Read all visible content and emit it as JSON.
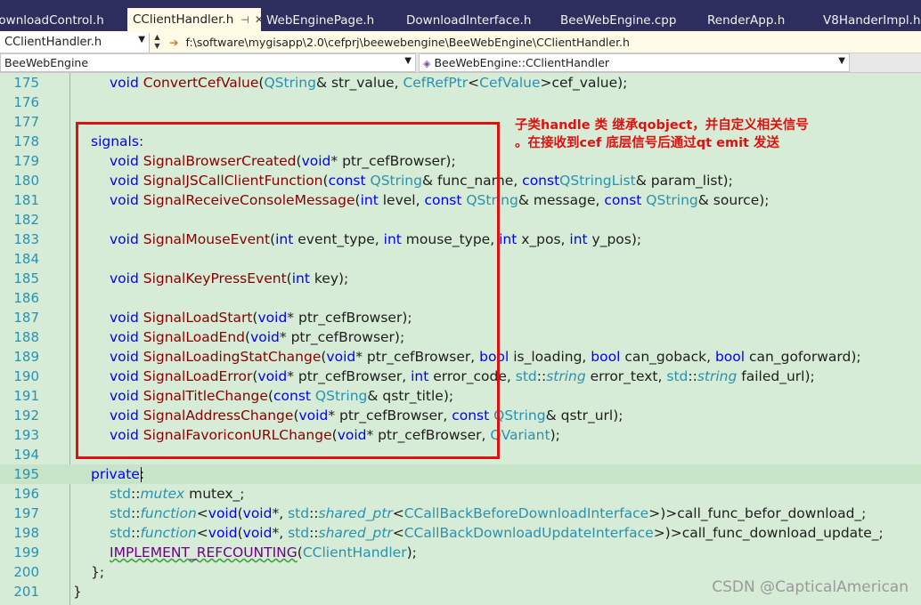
{
  "tabs": [
    {
      "label": "DownloadControl.h",
      "active": false
    },
    {
      "label": "CClientHandler.h",
      "active": true,
      "pin": "⊣",
      "close": "✕"
    },
    {
      "label": "WebEnginePage.h",
      "active": false
    },
    {
      "label": "DownloadInterface.h",
      "active": false
    },
    {
      "label": "BeeWebEngine.cpp",
      "active": false
    },
    {
      "label": "RenderApp.h",
      "active": false
    },
    {
      "label": "V8HanderImpl.h",
      "active": false
    }
  ],
  "pathbar": {
    "class_selector": "CClientHandler.h",
    "path": "f:\\software\\mygisapp\\2.0\\cefprj\\beewebengine\\BeeWebEngine\\CClientHandler.h"
  },
  "scopebar": {
    "project": "BeeWebEngine",
    "member": "BeeWebEngine::CClientHandler"
  },
  "code": {
    "lines": [
      {
        "n": "175",
        "html": "<span class='kw'>void</span> <span class='fn'>ConvertCefValue</span>(<span class='ty'>QString</span>&amp; str_value, <span class='ty'>CefRefPtr</span>&lt;<span class='ty'>CefValue</span>&gt;cef_value);",
        "indent": 2
      },
      {
        "n": "176",
        "html": "",
        "indent": 2
      },
      {
        "n": "177",
        "html": "",
        "indent": 2
      },
      {
        "n": "178",
        "html": "<span class='kw'>signals</span>:",
        "indent": 1
      },
      {
        "n": "179",
        "html": "<span class='kw'>void</span> <span class='fn'>SignalBrowserCreated</span>(<span class='kw'>void</span>* ptr_cefBrowser);",
        "indent": 2
      },
      {
        "n": "180",
        "html": "<span class='kw'>void</span> <span class='fn'>SignalJSCallClientFunction</span>(<span class='kw'>const</span> <span class='ty'>QString</span>&amp; func_name, <span class='kw'>const</span><span class='ty'>QStringList</span>&amp; param_list);",
        "indent": 2
      },
      {
        "n": "181",
        "html": "<span class='kw'>void</span> <span class='fn'>SignalReceiveConsoleMessage</span>(<span class='kw'>int</span> level, <span class='kw'>const</span> <span class='ty'>QString</span>&amp; message, <span class='kw'>const</span> <span class='ty'>QString</span>&amp; source);",
        "indent": 2
      },
      {
        "n": "182",
        "html": "",
        "indent": 2
      },
      {
        "n": "183",
        "html": "<span class='kw'>void</span> <span class='fn'>SignalMouseEvent</span>(<span class='kw'>int</span> event_type, <span class='kw'>int</span> mouse_type, <span class='kw'>int</span> x_pos, <span class='kw'>int</span> y_pos);",
        "indent": 2
      },
      {
        "n": "184",
        "html": "",
        "indent": 2
      },
      {
        "n": "185",
        "html": "<span class='kw'>void</span> <span class='fn'>SignalKeyPressEvent</span>(<span class='kw'>int</span> key);",
        "indent": 2
      },
      {
        "n": "186",
        "html": "",
        "indent": 2
      },
      {
        "n": "187",
        "html": "<span class='kw'>void</span> <span class='fn'>SignalLoadStart</span>(<span class='kw'>void</span>* ptr_cefBrowser);",
        "indent": 2
      },
      {
        "n": "188",
        "html": "<span class='kw'>void</span> <span class='fn'>SignalLoadEnd</span>(<span class='kw'>void</span>* ptr_cefBrowser);",
        "indent": 2
      },
      {
        "n": "189",
        "html": "<span class='kw'>void</span> <span class='fn'>SignalLoadingStatChange</span>(<span class='kw'>void</span>* ptr_cefBrowser, <span class='kw'>bool</span> is_loading, <span class='kw'>bool</span> can_goback, <span class='kw'>bool</span> can_goforward);",
        "indent": 2
      },
      {
        "n": "190",
        "html": "<span class='kw'>void</span> <span class='fn'>SignalLoadError</span>(<span class='kw'>void</span>* ptr_cefBrowser, <span class='kw'>int</span> error_code, <span class='ty'>std</span>::<span class='st'>string</span> error_text, <span class='ty'>std</span>::<span class='st'>string</span> failed_url);",
        "indent": 2
      },
      {
        "n": "191",
        "html": "<span class='kw'>void</span> <span class='fn'>SignalTitleChange</span>(<span class='kw'>const</span> <span class='ty'>QString</span>&amp; qstr_title);",
        "indent": 2
      },
      {
        "n": "192",
        "html": "<span class='kw'>void</span> <span class='fn'>SignalAddressChange</span>(<span class='kw'>void</span>* ptr_cefBrowser, <span class='kw'>const</span> <span class='ty'>QString</span>&amp; qstr_url);",
        "indent": 2
      },
      {
        "n": "193",
        "html": "<span class='kw'>void</span> <span class='fn'>SignalFavoriconURLChange</span>(<span class='kw'>void</span>* ptr_cefBrowser, <span class='ty'>QVariant</span>);",
        "indent": 2
      },
      {
        "n": "194",
        "html": "",
        "indent": 2
      },
      {
        "n": "195",
        "html": "<span class='kw'>private</span>:",
        "indent": 1,
        "cursor": true
      },
      {
        "n": "196",
        "html": "<span class='ty'>std</span>::<span class='st'>mutex</span> mutex_;",
        "indent": 2
      },
      {
        "n": "197",
        "html": "<span class='ty'>std</span>::<span class='st'>function</span>&lt;<span class='kw'>void</span>(<span class='kw'>void</span>*, <span class='ty'>std</span>::<span class='st'>shared_ptr</span>&lt;<span class='ty'>CCallBackBeforeDownloadInterface</span>&gt;)&gt;call_func_befor_download_;",
        "indent": 2
      },
      {
        "n": "198",
        "html": "<span class='ty'>std</span>::<span class='st'>function</span>&lt;<span class='kw'>void</span>(<span class='kw'>void</span>*, <span class='ty'>std</span>::<span class='st'>shared_ptr</span>&lt;<span class='ty'>CCallBackDownloadUpdateInterface</span>&gt;)&gt;call_func_download_update_;",
        "indent": 2
      },
      {
        "n": "199",
        "html": "<span class='mc sq'>IMPLEMENT_REFCOUNTING</span>(<span class='ty'>CClientHandler</span>);",
        "indent": 2
      },
      {
        "n": "200",
        "html": "};",
        "indent": 1
      },
      {
        "n": "201",
        "html": "}",
        "indent": 0
      }
    ]
  },
  "annotation": {
    "line1": "子类handle 类  继承qobject，并自定义相关信号",
    "line2": "。在接收到cef 底层信号后通过qt emit 发送",
    "color": "#e01010"
  },
  "watermark": "CSDN @CapticalAmerican"
}
